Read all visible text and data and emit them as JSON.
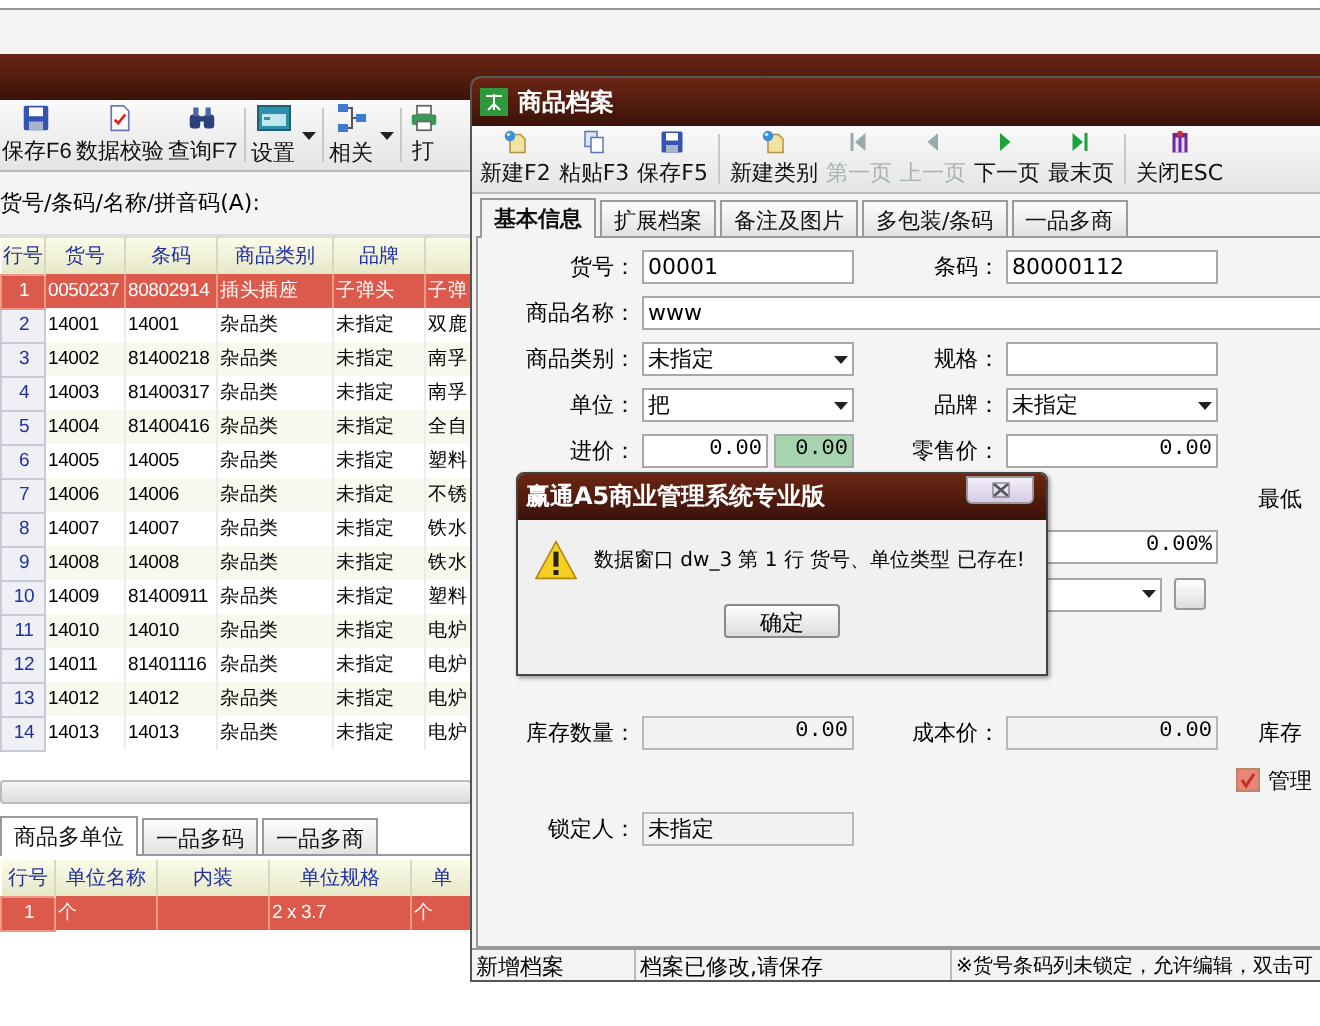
{
  "back_window": {
    "toolbar": [
      {
        "label": "保存F6",
        "dropdown": false
      },
      {
        "label": "数据校验",
        "dropdown": false
      },
      {
        "label": "查询F7",
        "dropdown": false
      },
      {
        "label": "设置",
        "dropdown": true
      },
      {
        "label": "相关",
        "dropdown": true
      },
      {
        "label": "打",
        "dropdown": false
      }
    ],
    "search": {
      "label": "货号/条码/名称/拼音码(A):"
    },
    "table": {
      "columns": [
        "行号",
        "货号",
        "条码",
        "商品类别",
        "品牌"
      ],
      "rows": [
        {
          "selected": true,
          "cells": [
            "1",
            "0050237",
            "80802914",
            "插头插座",
            "子弹头",
            "子弹"
          ]
        },
        {
          "selected": false,
          "cells": [
            "2",
            "14001",
            "14001",
            "杂品类",
            "未指定",
            "双鹿"
          ]
        },
        {
          "selected": false,
          "cells": [
            "3",
            "14002",
            "81400218",
            "杂品类",
            "未指定",
            "南孚"
          ]
        },
        {
          "selected": false,
          "cells": [
            "4",
            "14003",
            "81400317",
            "杂品类",
            "未指定",
            "南孚"
          ]
        },
        {
          "selected": false,
          "cells": [
            "5",
            "14004",
            "81400416",
            "杂品类",
            "未指定",
            "全自"
          ]
        },
        {
          "selected": false,
          "cells": [
            "6",
            "14005",
            "14005",
            "杂品类",
            "未指定",
            "塑料"
          ]
        },
        {
          "selected": false,
          "cells": [
            "7",
            "14006",
            "14006",
            "杂品类",
            "未指定",
            "不锈"
          ]
        },
        {
          "selected": false,
          "cells": [
            "8",
            "14007",
            "14007",
            "杂品类",
            "未指定",
            "铁水"
          ]
        },
        {
          "selected": false,
          "cells": [
            "9",
            "14008",
            "14008",
            "杂品类",
            "未指定",
            "铁水"
          ]
        },
        {
          "selected": false,
          "cells": [
            "10",
            "14009",
            "81400911",
            "杂品类",
            "未指定",
            "塑料"
          ]
        },
        {
          "selected": false,
          "cells": [
            "11",
            "14010",
            "14010",
            "杂品类",
            "未指定",
            "电炉"
          ]
        },
        {
          "selected": false,
          "cells": [
            "12",
            "14011",
            "81401116",
            "杂品类",
            "未指定",
            "电炉"
          ]
        },
        {
          "selected": false,
          "cells": [
            "13",
            "14012",
            "14012",
            "杂品类",
            "未指定",
            "电炉"
          ]
        },
        {
          "selected": false,
          "cells": [
            "14",
            "14013",
            "14013",
            "杂品类",
            "未指定",
            "电炉"
          ]
        }
      ]
    },
    "tabs": [
      {
        "label": "商品多单位",
        "selected": true
      },
      {
        "label": "一品多码",
        "selected": false
      },
      {
        "label": "一品多商",
        "selected": false
      }
    ],
    "unit_table": {
      "columns": [
        "行号",
        "单位名称",
        "内装",
        "单位规格",
        "单"
      ],
      "rows": [
        {
          "selected": true,
          "cells": [
            "1",
            "个",
            null,
            "2 x 3.7",
            "个"
          ]
        }
      ]
    }
  },
  "front_window": {
    "title": "商品档案",
    "toolbar": [
      {
        "label": "新建F2",
        "disabled": false
      },
      {
        "label": "粘贴F3",
        "disabled": false
      },
      {
        "label": "保存F5",
        "disabled": false
      },
      {
        "label": "新建类别",
        "disabled": false
      },
      {
        "label": "第一页",
        "disabled": true
      },
      {
        "label": "上一页",
        "disabled": true
      },
      {
        "label": "下一页",
        "disabled": false
      },
      {
        "label": "最末页",
        "disabled": false
      },
      {
        "label": "关闭ESC",
        "disabled": false
      }
    ],
    "tabs": [
      {
        "label": "基本信息",
        "selected": true
      },
      {
        "label": "扩展档案",
        "selected": false
      },
      {
        "label": "备注及图片",
        "selected": false
      },
      {
        "label": "多包装/条码",
        "selected": false
      },
      {
        "label": "一品多商",
        "selected": false
      }
    ],
    "form": {
      "rows": [
        {
          "left_label": "货号：",
          "left_field": {
            "kind": "text",
            "value": "00001",
            "readonly": false
          },
          "right_label": "条码：",
          "right_field": {
            "kind": "text",
            "value": "80000112",
            "readonly": false
          }
        },
        {
          "left_label": "商品名称：",
          "wide_field": {
            "kind": "text",
            "value": "www",
            "readonly": false
          }
        },
        {
          "left_label": "商品类别：",
          "left_field": {
            "kind": "dropdown",
            "value": "未指定",
            "readonly": false
          },
          "right_label": "规格：",
          "right_field": {
            "kind": "text",
            "readonly": false
          }
        },
        {
          "left_label": "单位：",
          "left_field": {
            "kind": "dropdown",
            "value": "把",
            "readonly": false
          },
          "right_label": "品牌：",
          "right_field": {
            "kind": "dropdown",
            "value": "未指定",
            "readonly": false
          }
        },
        {
          "left_label": "进价：",
          "left_field": {
            "kind": "price_pair",
            "values": [
              "0.00",
              "0.00"
            ],
            "readonly": false
          },
          "right_label": "零售价：",
          "right_field": {
            "kind": "number",
            "value": "0.00",
            "readonly": false
          }
        },
        {
          "far_label": "最低"
        },
        {
          "right_field": {
            "kind": "number",
            "value": "0.00%",
            "readonly": false
          }
        },
        {
          "right_field": {
            "kind": "dropdown_button",
            "readonly": false
          }
        },
        {
          "left_label": "库存数量：",
          "left_field": {
            "kind": "number",
            "value": "0.00",
            "readonly": true
          },
          "right_label": "成本价：",
          "right_field": {
            "kind": "number",
            "value": "0.00",
            "readonly": true
          },
          "far_label": "库存"
        },
        {
          "far_checkbox": {
            "label": "管理",
            "checked": true
          }
        },
        {
          "left_label": "锁定人：",
          "left_field": {
            "kind": "text",
            "value": "未指定",
            "readonly": true
          }
        }
      ]
    },
    "status_bar": [
      "新增档案",
      "档案已修改,请保存",
      "※货号条码列未锁定，允许编辑，双击可"
    ]
  },
  "message_box": {
    "title": "赢通A5商业管理系统专业版",
    "message": "数据窗口 dw_3 第 1 行 货号、单位类型 已存在!",
    "buttons": [
      "确定"
    ]
  }
}
